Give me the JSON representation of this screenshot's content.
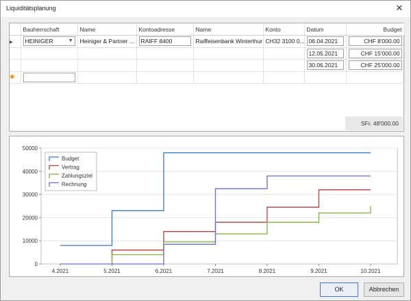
{
  "window": {
    "title": "Liquiditätsplanung",
    "close_icon": "close-icon"
  },
  "grid": {
    "columns": [
      "Bauherrschaft",
      "Name",
      "Kontoadresse",
      "Name",
      "Konto",
      "Datum",
      "Budget"
    ],
    "rows": [
      {
        "bauherrschaft": "HEINIGER",
        "name": "Heiniger & Partner ...",
        "kontoadresse": "RAIFF 8400",
        "bank": "Raiffeisenbank Winterthur",
        "konto": "CH32 3100 0...",
        "datum": "06.04.2021",
        "budget": "CHF 8'000.00"
      },
      {
        "bauherrschaft": "",
        "name": "",
        "kontoadresse": "",
        "bank": "",
        "konto": "",
        "datum": "12.05.2021",
        "budget": "CHF 15'000.00"
      },
      {
        "bauherrschaft": "",
        "name": "",
        "kontoadresse": "",
        "bank": "",
        "konto": "",
        "datum": "30.06.2021",
        "budget": "CHF 25'000.00"
      }
    ],
    "total": "SFr. 48'000.00"
  },
  "chart_data": {
    "type": "line",
    "step": true,
    "x": [
      "4.2021",
      "5.2021",
      "6.2021",
      "7.2021",
      "8.2021",
      "9.2021",
      "10.2021"
    ],
    "ylim": [
      0,
      50000
    ],
    "yticks": [
      0,
      10000,
      20000,
      30000,
      40000,
      50000
    ],
    "grid": true,
    "legend": "top-left",
    "series": [
      {
        "name": "Budget",
        "color": "#3a7bbf",
        "points": [
          [
            0,
            8000
          ],
          [
            1,
            8000
          ],
          [
            1,
            23000
          ],
          [
            2,
            23000
          ],
          [
            2,
            48000
          ],
          [
            6,
            48000
          ]
        ]
      },
      {
        "name": "Vertrag",
        "color": "#c0393b",
        "points": [
          [
            1,
            0
          ],
          [
            1,
            6000
          ],
          [
            2,
            6000
          ],
          [
            2,
            14000
          ],
          [
            3,
            14000
          ],
          [
            3,
            18000
          ],
          [
            4,
            18000
          ],
          [
            4,
            24500
          ],
          [
            5,
            24500
          ],
          [
            5,
            32000
          ],
          [
            6,
            32000
          ]
        ]
      },
      {
        "name": "Zahlungsziel",
        "color": "#7db33a",
        "points": [
          [
            1,
            0
          ],
          [
            1,
            4000
          ],
          [
            2,
            4000
          ],
          [
            2,
            9500
          ],
          [
            3,
            9500
          ],
          [
            3,
            13000
          ],
          [
            4,
            13000
          ],
          [
            4,
            18000
          ],
          [
            5,
            18000
          ],
          [
            5,
            22000
          ],
          [
            6,
            22000
          ],
          [
            6,
            25000
          ]
        ]
      },
      {
        "name": "Rechnung",
        "color": "#6b6bdc",
        "points": [
          [
            0,
            0
          ],
          [
            2,
            0
          ],
          [
            2,
            8500
          ],
          [
            3,
            8500
          ],
          [
            3,
            32500
          ],
          [
            4,
            32500
          ],
          [
            4,
            38000
          ],
          [
            6,
            38000
          ]
        ]
      }
    ]
  },
  "buttons": {
    "ok": "OK",
    "cancel": "Abbrechen"
  }
}
